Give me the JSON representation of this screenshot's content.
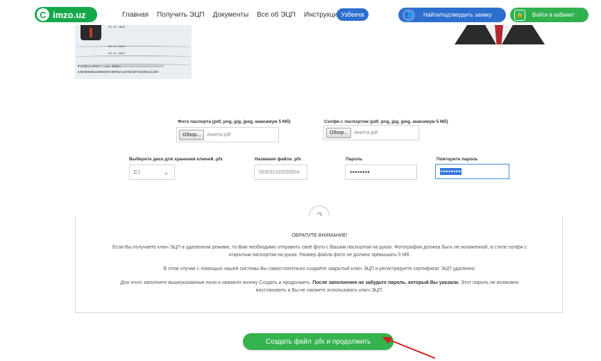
{
  "header": {
    "logo_mark": "C",
    "logo_text": "imzo.uz",
    "nav": [
      "Главная",
      "Получить ЭЦП",
      "Документы",
      "Все об ЭЦП",
      "Инструкции"
    ],
    "lang": "Узбекча",
    "find_button": "Найти/подтвердить заявку",
    "login_button": "Войти в кабинет"
  },
  "passport": {
    "lines": [
      "25.07.1983",
      "04.11.2012",
      "02.11.2022"
    ],
    "mrz1": "P<UZBAIJUMOT<<<BILONBEK<<<<<<<<<<<<<<<<<<<<<<<",
    "mrz2": "AA03696882UZB8307265M2211078230725330111486"
  },
  "form": {
    "passport_photo_label": "Фото паспорта (pdf, png, jpg, jpeg, максимум 5 Мб)",
    "selfie_label": "Селфи с паспортом (pdf, png, jpg, jpeg, максимум 5 Мб)",
    "browse": "Обзор...",
    "file1": "Анкета.pdf",
    "file2": "Анкета.pdf",
    "disk_label": "Выберите диск для хранения ключей .pfx",
    "disk_value": "C:\\",
    "filename_label": "Название файла .pfx",
    "filename_value": "053031232030004",
    "password_label": "Пароль",
    "password_value": "••••••••",
    "repeat_label": "Повторите пароль",
    "repeat_value": "••••••••"
  },
  "notice": {
    "icon": "?",
    "title": "ОБРАТИТЕ ВНИМАНИЕ!",
    "p1": "Если Вы получаете ключ ЭЦП в удаленном режиме, то Вам необходимо отправить своё фото с Вашим паспортом на руках. Фотография должна быть не искаженной, в стиле селфи с открытым паспортом на руках. Размер файла фото не должно превышать 5 Мб.",
    "p2": "В этом случае с помощью нашей системы Вы самостоятельно создаёте закрытый ключ ЭЦП и регистрируете сертификат ЭЦП удаленно.",
    "p3_a": "Для этого заполните вышеуказанные поля и нажмите кнопку Создать и продолжить.",
    "p3_b": "После заполнения не забудьте пароль, который Вы указали.",
    "p3_c": "Этот пароль не возможно восстановить и Вы не сможете использовать ключ ЭЦП."
  },
  "submit": "Создать файл .pfx и продолжить",
  "colors": {
    "green": "#34b34e",
    "blue": "#2d6fcf",
    "arrow": "#d11f1f"
  }
}
